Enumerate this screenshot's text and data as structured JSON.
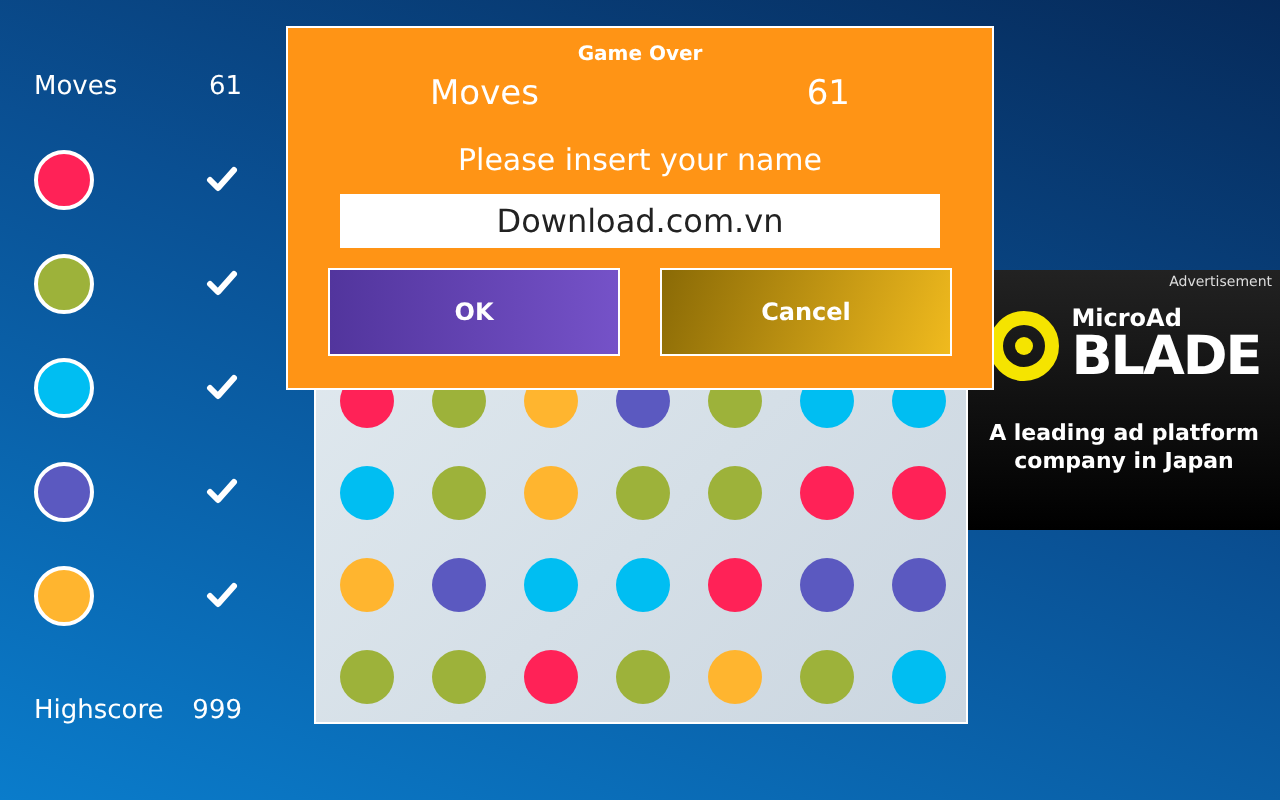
{
  "sidebar": {
    "moves_label": "Moves",
    "moves_value": "61",
    "colors": [
      {
        "color": "#ff2257",
        "checked": true
      },
      {
        "color": "#9db23a",
        "checked": true
      },
      {
        "color": "#00bef2",
        "checked": true
      },
      {
        "color": "#5b59c0",
        "checked": true
      },
      {
        "color": "#ffb52f",
        "checked": true
      }
    ],
    "highscore_label": "Highscore",
    "highscore_value": "999"
  },
  "board": {
    "rows": [
      {
        "dots": [
          {
            "color": "#ff2257"
          },
          {
            "color": "#9db23a"
          },
          {
            "color": "#ffb52f"
          },
          {
            "color": "#5b59c0"
          },
          {
            "color": "#9db23a"
          },
          {
            "color": "#00bef2"
          },
          {
            "color": "#00bef2"
          }
        ]
      },
      {
        "dots": [
          {
            "color": "#00bef2"
          },
          {
            "color": "#9db23a"
          },
          {
            "color": "#ffb52f"
          },
          {
            "color": "#9db23a"
          },
          {
            "color": "#9db23a"
          },
          {
            "color": "#ff2257"
          },
          {
            "color": "#ff2257"
          }
        ]
      },
      {
        "dots": [
          {
            "color": "#ffb52f"
          },
          {
            "color": "#5b59c0"
          },
          {
            "color": "#00bef2"
          },
          {
            "color": "#00bef2"
          },
          {
            "color": "#ff2257"
          },
          {
            "color": "#5b59c0"
          },
          {
            "color": "#5b59c0"
          }
        ]
      },
      {
        "dots": [
          {
            "color": "#9db23a"
          },
          {
            "color": "#9db23a"
          },
          {
            "color": "#ff2257"
          },
          {
            "color": "#9db23a"
          },
          {
            "color": "#ffb52f"
          },
          {
            "color": "#9db23a"
          },
          {
            "color": "#00bef2"
          }
        ]
      }
    ]
  },
  "dialog": {
    "title": "Game Over",
    "moves_label": "Moves",
    "moves_value": "61",
    "prompt": "Please insert your name",
    "name_value": "Download.com.vn",
    "buttons": [
      {
        "label": "OK",
        "kind": "primary"
      },
      {
        "label": "Cancel",
        "kind": "secondary"
      }
    ]
  },
  "ad": {
    "tag": "Advertisement",
    "brand_small": "MicroAd",
    "brand_large": "BLADE",
    "tagline": "A leading ad platform company in Japan"
  }
}
